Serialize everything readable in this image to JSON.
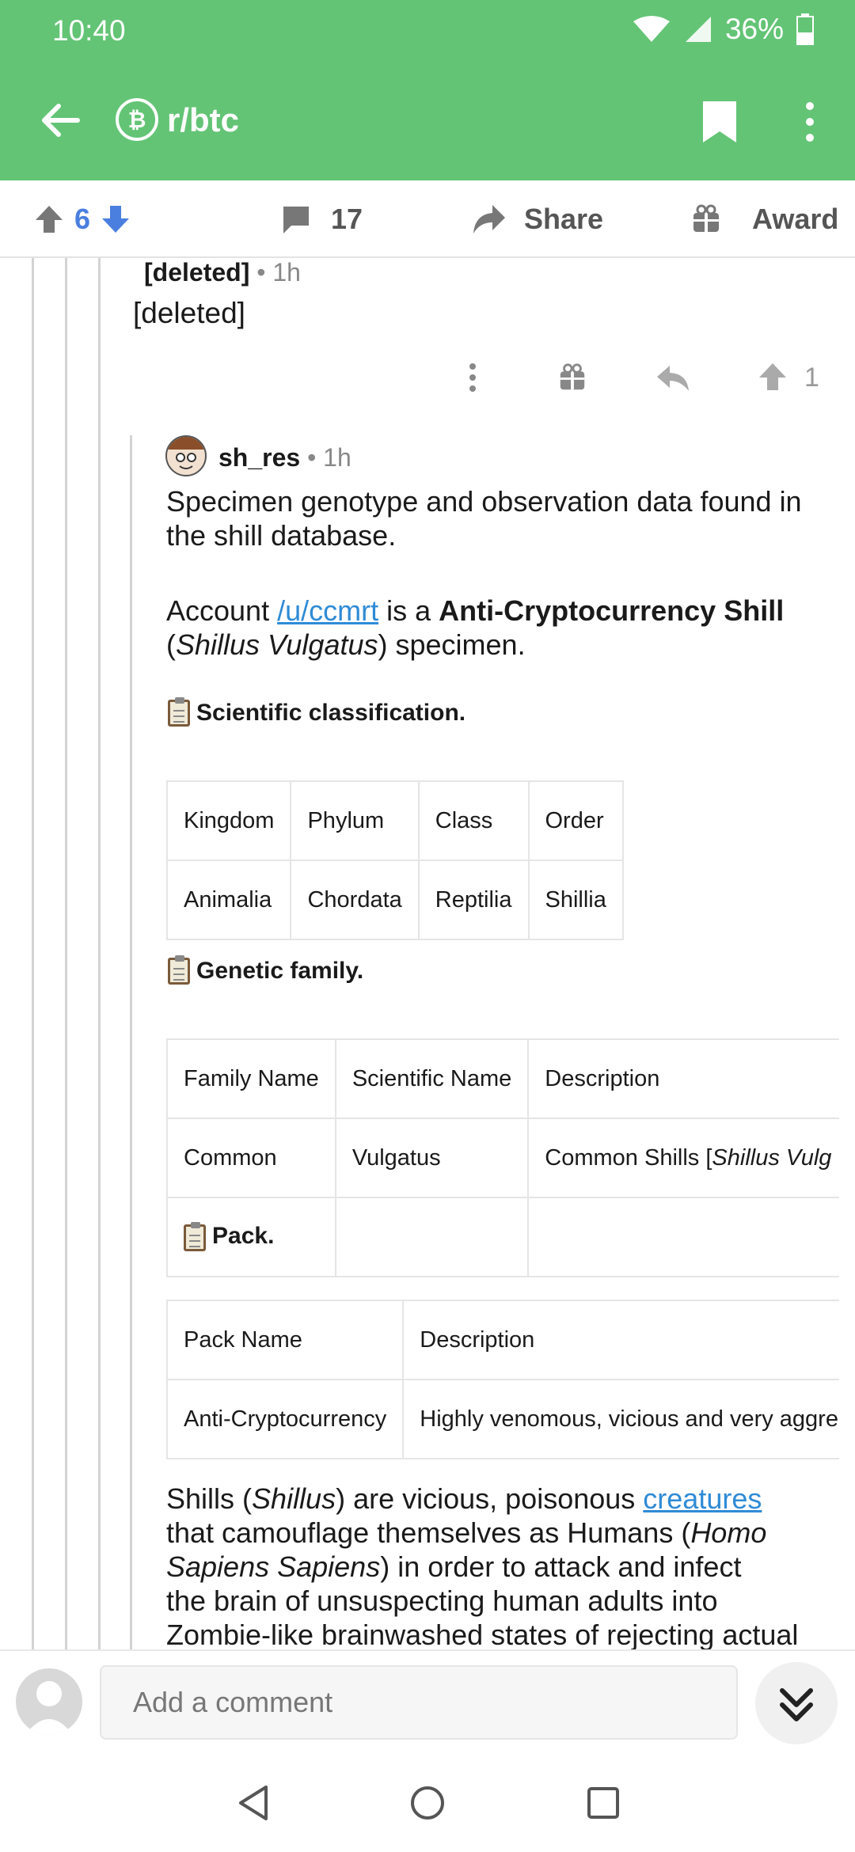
{
  "status_bar": {
    "time": "10:40",
    "battery": "36%"
  },
  "toolbar": {
    "subreddit": "r/btc"
  },
  "action_bar": {
    "score": "6",
    "comments": "17",
    "share": "Share",
    "award": "Award"
  },
  "deleted_comment": {
    "author": "[deleted]",
    "age": "1h",
    "body": "[deleted]",
    "upvotes": "1"
  },
  "comment": {
    "author": "sh_res",
    "age": "1h",
    "intro": "Specimen genotype and observation data found in the shill database.",
    "account_prefix": "Account ",
    "account_link": "/u/ccmrt",
    "account_mid": " is a ",
    "account_bold": "Anti-Cryptocurrency Shill",
    "account_paren_open": "(",
    "account_italic": "Shillus Vulgatus",
    "account_suffix": ") specimen.",
    "heading_classification": "Scientific classification.",
    "classification_table": {
      "headers": [
        "Kingdom",
        "Phylum",
        "Class",
        "Order"
      ],
      "row": [
        "Animalia",
        "Chordata",
        "Reptilia",
        "Shillia"
      ]
    },
    "heading_genetic": "Genetic family.",
    "genetic_table": {
      "headers": [
        "Family Name",
        "Scientific Name",
        "Description"
      ],
      "row": [
        "Common",
        "Vulgatus",
        "Common Shills [",
        "Shillus Vulg"
      ],
      "extra_row_label": "Pack."
    },
    "pack_table": {
      "headers": [
        "Pack Name",
        "Description"
      ],
      "row": [
        "Anti-Cryptocurrency",
        "Highly venomous, vicious and very aggre"
      ]
    },
    "para": {
      "p1": "Shills (",
      "p1_italic": "Shillus",
      "p2": ") are vicious, poisonous ",
      "p2_link": "creatures",
      "p3": "that camouflage themselves as Humans (",
      "p3_italic": "Homo Sapiens Sapiens",
      "p4": ") in order to attack and infect",
      "p5": "the brain of unsuspecting human adults into",
      "p6": "Zombie-like brainwashed states of rejecting actual"
    }
  },
  "bottom_bar": {
    "placeholder": "Add a comment"
  },
  "colors": {
    "accent": "#63c475",
    "link": "#2f8bd6",
    "upvote_blue": "#4a7fe0"
  }
}
